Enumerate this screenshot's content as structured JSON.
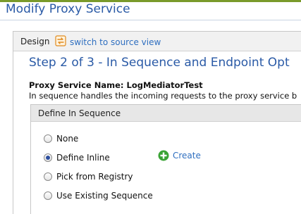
{
  "page": {
    "title": "Modify Proxy Service"
  },
  "tabs": {
    "design_label": "Design",
    "switch_label": "switch to source view",
    "switch_icon": "switch-view-icon"
  },
  "step": {
    "title": "Step 2 of 3 - In Sequence and Endpoint Opt",
    "service_name": "Proxy Service Name: LogMediatorTest",
    "description": "In sequence handles the incoming requests to the proxy service b"
  },
  "in_sequence": {
    "header": "Define In Sequence",
    "options": [
      {
        "label": "None",
        "selected": false
      },
      {
        "label": "Define Inline",
        "selected": true
      },
      {
        "label": "Pick from Registry",
        "selected": false
      },
      {
        "label": "Use Existing Sequence",
        "selected": false
      }
    ],
    "create_label": "Create",
    "create_icon": "plus-circle-icon"
  },
  "colors": {
    "accent_blue": "#2a5aa6",
    "link_blue": "#2f6fc0",
    "top_bar_green": "#7a9a2a",
    "create_green": "#3aa335"
  }
}
